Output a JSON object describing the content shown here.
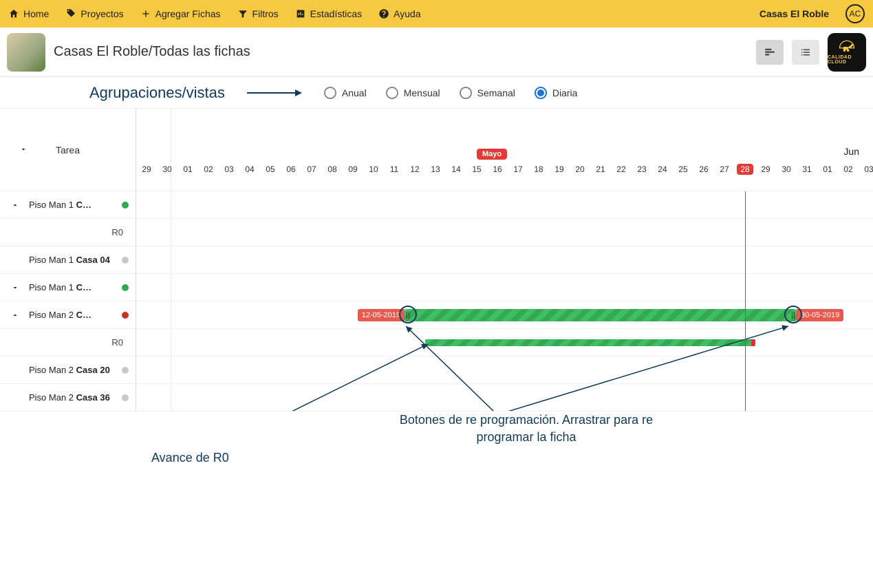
{
  "nav": {
    "home": "Home",
    "projects": "Proyectos",
    "add": "Agregar Fichas",
    "filters": "Filtros",
    "stats": "Estadísticas",
    "help": "Ayuda",
    "user": "Casas El Roble",
    "avatar": "AC"
  },
  "subheader": {
    "title": "Casas El Roble/Todas las fichas",
    "logo_label": "CALIDAD CLOUD"
  },
  "views": {
    "title": "Agrupaciones/vistas",
    "options": {
      "annual": "Anual",
      "monthly": "Mensual",
      "weekly": "Semanal",
      "daily": "Diaria"
    },
    "selected": "daily"
  },
  "gantt": {
    "task_header": "Tarea",
    "month_main": "Mayo",
    "month_next": "Jun",
    "days": [
      "29",
      "30",
      "01",
      "02",
      "03",
      "04",
      "05",
      "06",
      "07",
      "08",
      "09",
      "10",
      "11",
      "12",
      "13",
      "14",
      "15",
      "16",
      "17",
      "18",
      "19",
      "20",
      "21",
      "22",
      "23",
      "24",
      "25",
      "26",
      "27",
      "28",
      "29",
      "30",
      "31",
      "01",
      "02",
      "03"
    ],
    "today_index": 29,
    "tasks": [
      {
        "label": "Piso Man 1",
        "bold": "C…",
        "status": "green",
        "expander": "up"
      },
      {
        "label_plain": "R0",
        "sub": true
      },
      {
        "label": "Piso Man 1",
        "bold": "Casa 04",
        "status": "grey"
      },
      {
        "label": "Piso Man 1",
        "bold": "C…",
        "status": "green",
        "expander": "down"
      },
      {
        "label": "Piso Man 2",
        "bold": "C…",
        "status": "red",
        "expander": "up"
      },
      {
        "label_plain": "R0",
        "sub": true
      },
      {
        "label": "Piso Man 2",
        "bold": "Casa 20",
        "status": "grey"
      },
      {
        "label": "Piso Man 2",
        "bold": "Casa 36",
        "status": "grey"
      }
    ],
    "bar_main": {
      "start_date": "12-05-2019",
      "end_date": "30-05-2019"
    },
    "annotations": {
      "btns": "Botones de re programación. Arrastrar para re programar la ficha",
      "avance": "Avance de R0"
    }
  }
}
